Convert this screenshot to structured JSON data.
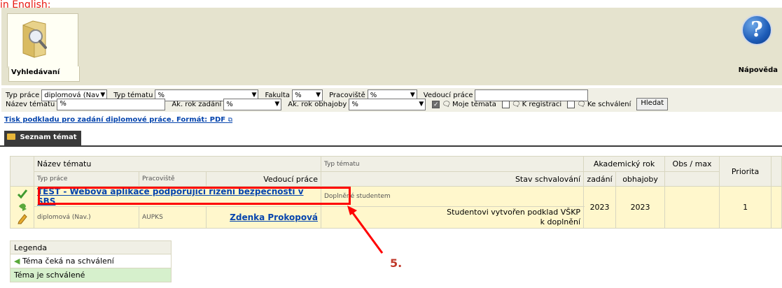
{
  "note": "in English:",
  "toolbar": {
    "search_label": "Vyhledávaní",
    "help_label": "Nápověda",
    "help_glyph": "?"
  },
  "filters": {
    "typ_prace_label": "Typ práce",
    "typ_prace_value": "diplomová (Nav.)",
    "typ_tematu_label": "Typ tématu",
    "typ_tematu_value": "%",
    "fakulta_label": "Fakulta",
    "fakulta_value": "%",
    "pracoviste_label": "Pracoviště",
    "pracoviste_value": "%",
    "vedouci_label": "Vedoucí práce",
    "vedouci_value": "",
    "nazev_label": "Název tématu",
    "nazev_value": "%",
    "ak_rok_zadani_label": "Ak. rok zadání",
    "ak_rok_zadani_value": "%",
    "ak_rok_obhajoby_label": "Ak. rok obhajoby",
    "ak_rok_obhajoby_value": "%",
    "moje_temata_label": "Moje témata",
    "moje_temata_checked": true,
    "k_registraci_label": "K registraci",
    "ke_schvaleni_label": "Ke schválení",
    "search_button": "Hledat"
  },
  "print_link": "Tisk podkladu pro zadání diplomové práce. Formát: PDF",
  "tab_label": "Seznam témat",
  "table": {
    "headers": {
      "nazev": "Název tématu",
      "typ_prace": "Typ práce",
      "pracoviste": "Pracoviště",
      "vedouci": "Vedoucí práce",
      "typ_tematu": "Typ tématu",
      "stav": "Stav schvalování",
      "akademicky_rok": "Akademický rok",
      "zadani": "zadání",
      "obhajoby": "obhajoby",
      "obs_max": "Obs / max",
      "priorita": "Priorita"
    },
    "rows": [
      {
        "nazev": "TEST - Webová aplikace podporující řízení bezpečnosti v SBS",
        "typ_prace": "diplomová (Nav.)",
        "pracoviste": "AUPKS",
        "vedouci": "Zdenka Prokopová",
        "typ_tematu": "Doplněné studentem",
        "stav_line1": "Studentovi vytvořen podklad VŠKP",
        "stav_line2": "k doplnění",
        "zadani": "2023",
        "obhajoby": "2023",
        "obs_max": "",
        "priorita": "1"
      }
    ]
  },
  "legend": {
    "title": "Legenda",
    "items": [
      {
        "label": "Téma čeká na schválení"
      },
      {
        "label": "Téma je schválené"
      }
    ]
  },
  "annotation": {
    "number": "5."
  },
  "colors": {
    "toolbar_bg": "#e5e3ce",
    "filter_bg": "#f0efe5",
    "row_highlight": "#fff7cc",
    "link": "#0645ad",
    "annotation_red": "#ff0000"
  }
}
